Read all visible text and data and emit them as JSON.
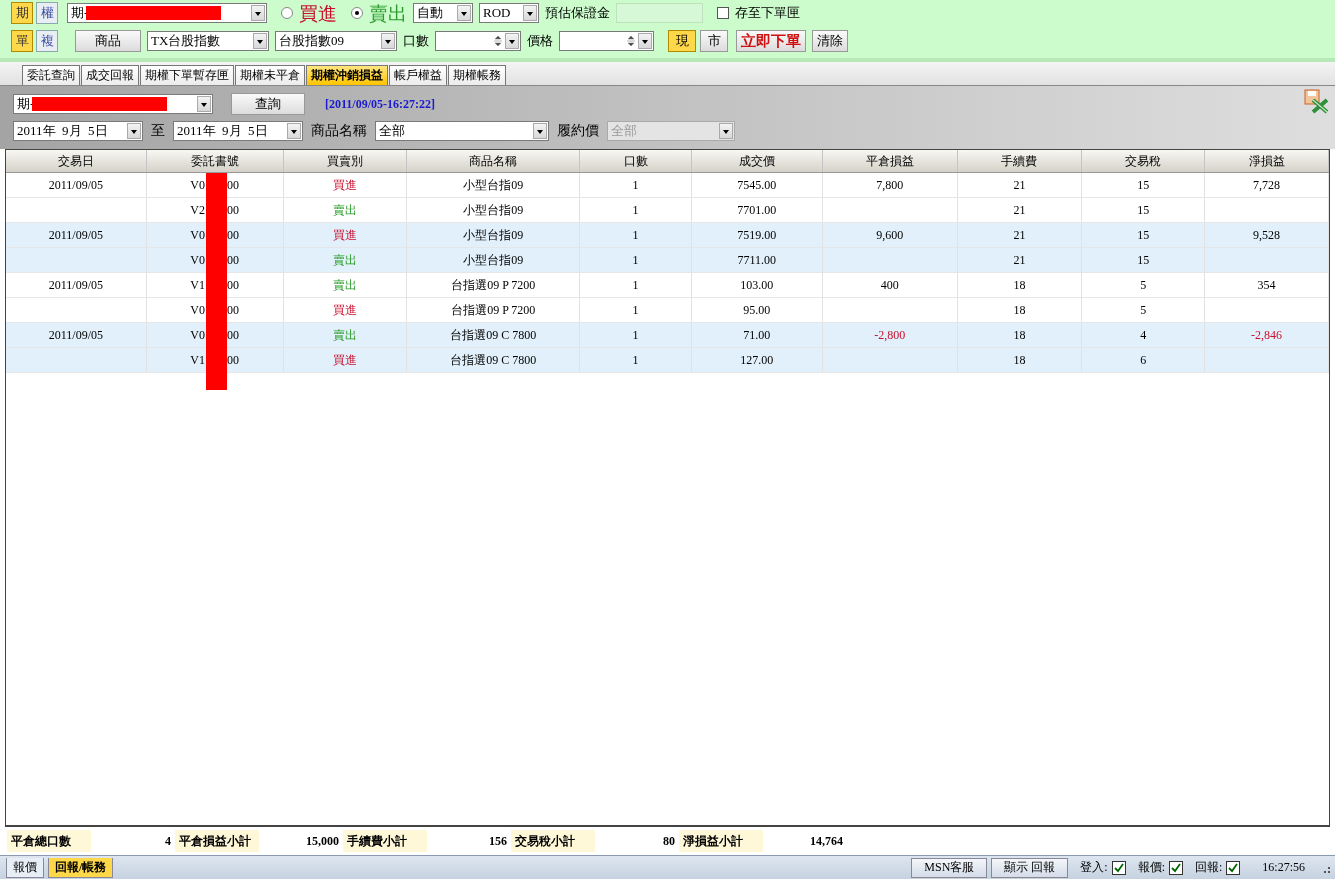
{
  "order_panel": {
    "row1": {
      "type_buttons": [
        {
          "label": "期",
          "selected": true
        },
        {
          "label": "權",
          "selected": false
        }
      ],
      "account": {
        "value_prefix": "期-"
      },
      "sides": [
        {
          "label": "買進",
          "selected": false,
          "kind": "buy"
        },
        {
          "label": "賣出",
          "selected": true,
          "kind": "sell"
        }
      ],
      "condition": {
        "value": "自動"
      },
      "time_in_force": {
        "value": "ROD"
      },
      "margin_label": "預估保證金",
      "save_to_queue": {
        "label": "存至下單匣",
        "checked": false
      }
    },
    "row2": {
      "mode_buttons": [
        {
          "label": "單",
          "selected": true
        },
        {
          "label": "複",
          "selected": false
        }
      ],
      "product_button": "商品",
      "commodity": {
        "value": "TX台股指數"
      },
      "contract": {
        "value": "台股指數09"
      },
      "quantity_label": "口數",
      "price_label": "價格",
      "price_type_buttons": [
        {
          "label": "現",
          "selected": true
        },
        {
          "label": "市",
          "selected": false
        }
      ],
      "submit_button": "立即下單",
      "clear_button": "清除"
    }
  },
  "tabs": [
    {
      "label": "委託查詢",
      "selected": false
    },
    {
      "label": "成交回報",
      "selected": false
    },
    {
      "label": "期權下單暫存匣",
      "selected": false
    },
    {
      "label": "期權未平倉",
      "selected": false
    },
    {
      "label": "期權沖銷損益",
      "selected": true
    },
    {
      "label": "帳戶權益",
      "selected": false
    },
    {
      "label": "期權帳務",
      "selected": false
    }
  ],
  "query": {
    "account": {
      "value_prefix": "期-"
    },
    "query_button": "查詢",
    "timestamp": "[2011/09/05-16:27:22]",
    "date_from": "2011年  9月  5日",
    "to_label": "至",
    "date_to": "2011年  9月  5日",
    "product_label": "商品名稱",
    "product": {
      "value": "全部"
    },
    "strike_label": "履約價",
    "strike": {
      "value": "全部",
      "disabled": true
    }
  },
  "table": {
    "columns": [
      "交易日",
      "委託書號",
      "買賣別",
      "商品名稱",
      "口數",
      "成交價",
      "平倉損益",
      "手續費",
      "交易稅",
      "淨損益"
    ],
    "rows": [
      {
        "date": "2011/09/05",
        "order_no_start": "V0",
        "order_no_end": "00",
        "side": "買進",
        "kind": "buy",
        "product": "小型台指09",
        "qty": "1",
        "price": "7545.00",
        "pnl": "7,800",
        "fee": "21",
        "tax": "15",
        "net": "7,728",
        "loss": false,
        "shaded": false
      },
      {
        "order_no_start": "V2",
        "order_no_end": "00",
        "side": "賣出",
        "kind": "sell",
        "product": "小型台指09",
        "qty": "1",
        "price": "7701.00",
        "fee": "21",
        "tax": "15",
        "shaded": false
      },
      {
        "date": "2011/09/05",
        "order_no_start": "V0",
        "order_no_end": "00",
        "side": "買進",
        "kind": "buy",
        "product": "小型台指09",
        "qty": "1",
        "price": "7519.00",
        "pnl": "9,600",
        "fee": "21",
        "tax": "15",
        "net": "9,528",
        "loss": false,
        "shaded": true
      },
      {
        "order_no_start": "V0",
        "order_no_end": "00",
        "side": "賣出",
        "kind": "sell",
        "product": "小型台指09",
        "qty": "1",
        "price": "7711.00",
        "fee": "21",
        "tax": "15",
        "shaded": true
      },
      {
        "date": "2011/09/05",
        "order_no_start": "V1",
        "order_no_end": "00",
        "side": "賣出",
        "kind": "sell",
        "product": "台指選09 P 7200",
        "qty": "1",
        "price": "103.00",
        "pnl": "400",
        "fee": "18",
        "tax": "5",
        "net": "354",
        "loss": false,
        "shaded": false
      },
      {
        "order_no_start": "V0",
        "order_no_end": "00",
        "side": "買進",
        "kind": "buy",
        "product": "台指選09 P 7200",
        "qty": "1",
        "price": "95.00",
        "fee": "18",
        "tax": "5",
        "shaded": false
      },
      {
        "date": "2011/09/05",
        "order_no_start": "V0",
        "order_no_end": "00",
        "side": "賣出",
        "kind": "sell",
        "product": "台指選09 C 7800",
        "qty": "1",
        "price": "71.00",
        "pnl": "-2,800",
        "fee": "18",
        "tax": "4",
        "net": "-2,846",
        "loss": true,
        "shaded": true
      },
      {
        "order_no_start": "V1",
        "order_no_end": "00",
        "side": "買進",
        "kind": "buy",
        "product": "台指選09 C 7800",
        "qty": "1",
        "price": "127.00",
        "fee": "18",
        "tax": "6",
        "shaded": true
      }
    ]
  },
  "summary": [
    {
      "label": "平倉總口數",
      "value": "4"
    },
    {
      "label": "平倉損益小計",
      "value": "15,000"
    },
    {
      "label": "手續費小計",
      "value": "156"
    },
    {
      "label": "交易稅小計",
      "value": "80"
    },
    {
      "label": "淨損益小計",
      "value": "14,764"
    }
  ],
  "status_bar": {
    "tabs": [
      {
        "label": "報價",
        "selected": false
      },
      {
        "label": "回報/帳務",
        "selected": true
      }
    ],
    "buttons": [
      "MSN客服",
      "顯示 回報"
    ],
    "indicators": [
      {
        "label": "登入:",
        "checked": true
      },
      {
        "label": "報價:",
        "checked": true
      },
      {
        "label": "回報:",
        "checked": true
      }
    ],
    "time": "16:27:56"
  }
}
